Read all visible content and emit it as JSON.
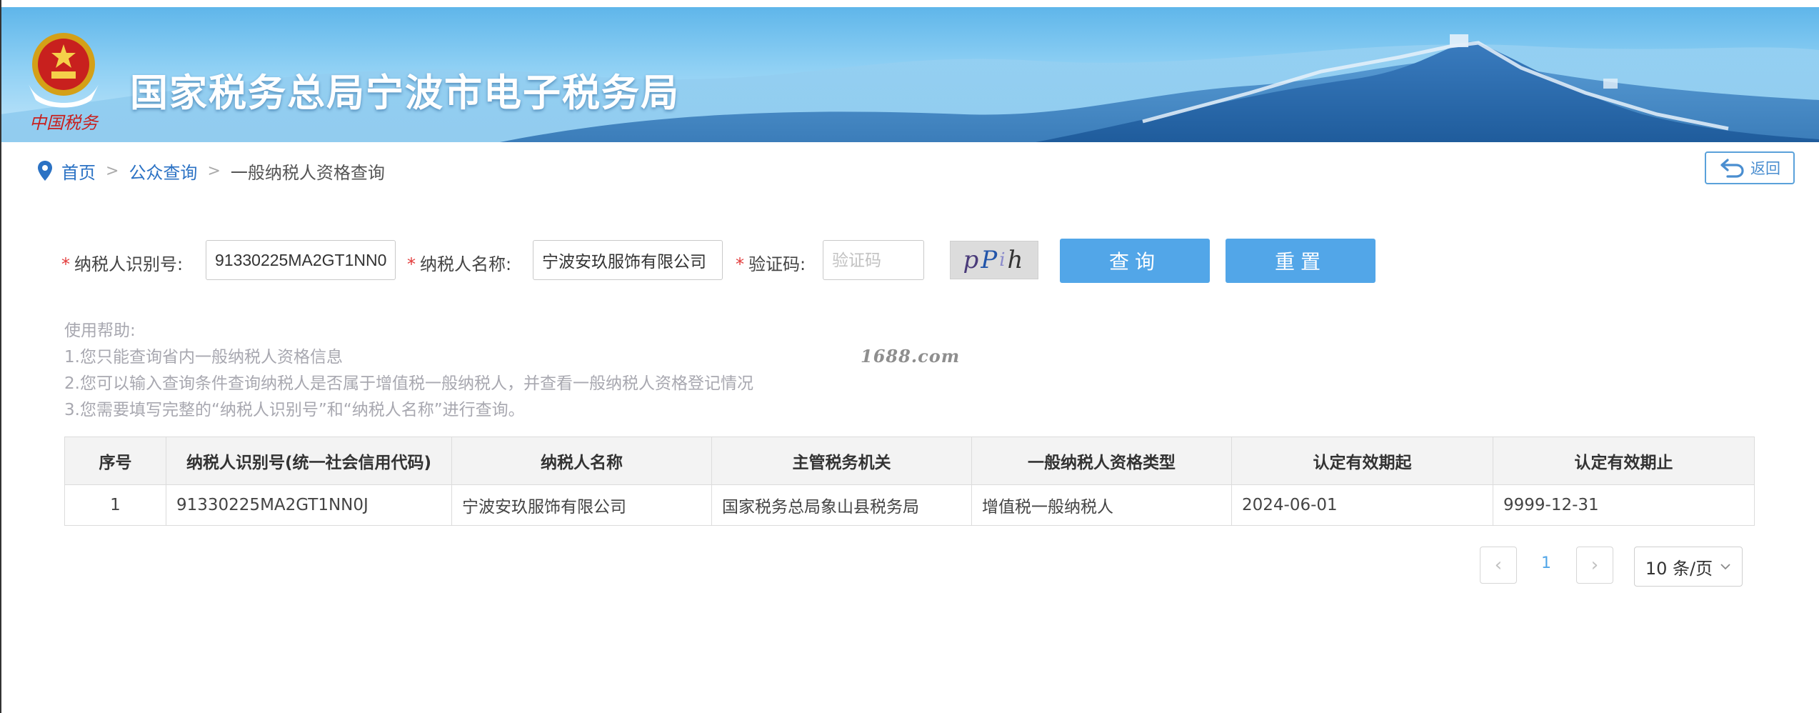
{
  "header": {
    "title": "国家税务总局宁波市电子税务局",
    "emblem_caption": "中国税务"
  },
  "breadcrumb": {
    "home": "首页",
    "section": "公众查询",
    "current": "一般纳税人资格查询",
    "separator": ">"
  },
  "back_button": {
    "label": "返回"
  },
  "search": {
    "taxpayer_id_label": "纳税人识别号:",
    "taxpayer_id_value": "91330225MA2GT1NN0J",
    "taxpayer_name_label": "纳税人名称:",
    "taxpayer_name_value": "宁波安玖服饰有限公司",
    "captcha_label": "验证码:",
    "captcha_placeholder": "验证码",
    "captcha_text": [
      "p",
      "P",
      "i",
      "h"
    ],
    "required_mark": "*",
    "query_button": "查询",
    "reset_button": "重置"
  },
  "help": {
    "title": "使用帮助:",
    "lines": [
      "1.您只能查询省内一般纳税人资格信息",
      "2.您可以输入查询条件查询纳税人是否属于增值税一般纳税人，并查看一般纳税人资格登记情况",
      "3.您需要填写完整的“纳税人识别号”和“纳税人名称”进行查询。"
    ]
  },
  "watermark": "1688.com",
  "table": {
    "columns": [
      "序号",
      "纳税人识别号(统一社会信用代码)",
      "纳税人名称",
      "主管税务机关",
      "一般纳税人资格类型",
      "认定有效期起",
      "认定有效期止"
    ],
    "rows": [
      [
        "1",
        "91330225MA2GT1NN0J",
        "宁波安玖服饰有限公司",
        "国家税务总局象山县税务局",
        "增值税一般纳税人",
        "2024-06-01",
        "9999-12-31"
      ]
    ]
  },
  "pagination": {
    "current_page": "1",
    "page_size": "10 条/页",
    "prev": "‹",
    "next": "›"
  },
  "colors": {
    "primary": "#52a6e8",
    "link": "#2b72c4",
    "required": "#e23b3b",
    "help_text": "#a8a8b0"
  }
}
